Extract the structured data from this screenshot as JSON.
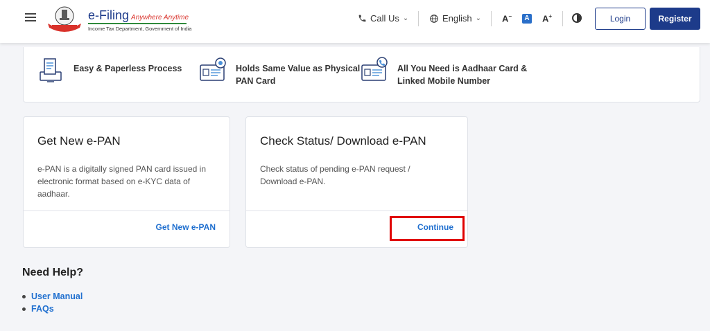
{
  "header": {
    "logo": {
      "title": "e-Filing",
      "tagline": "Anywhere Anytime",
      "subtitle": "Income Tax Department, Government of India",
      "emblem_icon": "national-emblem-icon"
    },
    "call_us": "Call Us",
    "language": "English",
    "font_decrease": "A",
    "font_normal": "A",
    "font_increase": "A",
    "login_label": "Login",
    "register_label": "Register"
  },
  "features": [
    {
      "icon": "document-monitor-icon",
      "text": "Easy & Paperless Process"
    },
    {
      "icon": "pan-card-icon",
      "text": "Holds Same Value as Physical PAN Card"
    },
    {
      "icon": "aadhaar-phone-icon",
      "text": "All You Need is Aadhaar Card & Linked Mobile Number"
    }
  ],
  "cards": [
    {
      "title": "Get New e-PAN",
      "description": "e-PAN is a digitally signed PAN card issued in electronic format based on e-KYC data of aadhaar.",
      "action": "Get New e-PAN"
    },
    {
      "title": "Check Status/ Download e-PAN",
      "description": "Check status of pending e-PAN request / Download e-PAN.",
      "action": "Continue"
    }
  ],
  "help": {
    "title": "Need Help?",
    "links": [
      "User Manual",
      "FAQs"
    ]
  },
  "colors": {
    "brand": "#1d3b8a",
    "link": "#1f6fcf",
    "highlight": "#e00000",
    "background": "#f4f5f8"
  }
}
